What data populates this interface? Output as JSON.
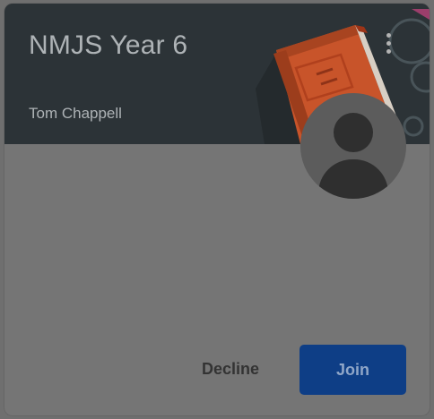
{
  "class_card": {
    "title": "NMJS Year 6",
    "teacher": "Tom Chappell",
    "decline_label": "Decline",
    "join_label": "Join",
    "banner_color": "#2c3337",
    "join_color": "#0e3e86",
    "book_color": "#c8542a"
  },
  "icons": {
    "menu": "more-vert-icon",
    "avatar": "person-avatar-icon",
    "banner": "book-illustration"
  }
}
